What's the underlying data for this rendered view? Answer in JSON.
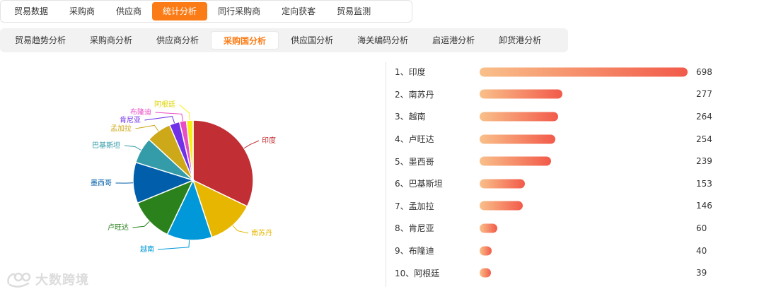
{
  "top_nav": {
    "tabs": [
      {
        "label": "贸易数据",
        "active": false
      },
      {
        "label": "采购商",
        "active": false
      },
      {
        "label": "供应商",
        "active": false
      },
      {
        "label": "统计分析",
        "active": true
      },
      {
        "label": "同行采购商",
        "active": false
      },
      {
        "label": "定向获客",
        "active": false
      },
      {
        "label": "贸易监测",
        "active": false
      }
    ]
  },
  "sub_nav": {
    "tabs": [
      {
        "label": "贸易趋势分析",
        "active": false
      },
      {
        "label": "采购商分析",
        "active": false
      },
      {
        "label": "供应商分析",
        "active": false
      },
      {
        "label": "采购国分析",
        "active": true
      },
      {
        "label": "供应国分析",
        "active": false
      },
      {
        "label": "海关编码分析",
        "active": false
      },
      {
        "label": "启运港分析",
        "active": false
      },
      {
        "label": "卸货港分析",
        "active": false
      }
    ]
  },
  "ranking": {
    "max": 698,
    "items": [
      {
        "rank_label": "1、印度",
        "value": 698
      },
      {
        "rank_label": "2、南苏丹",
        "value": 277
      },
      {
        "rank_label": "3、越南",
        "value": 264
      },
      {
        "rank_label": "4、卢旺达",
        "value": 254
      },
      {
        "rank_label": "5、墨西哥",
        "value": 239
      },
      {
        "rank_label": "6、巴基斯坦",
        "value": 153
      },
      {
        "rank_label": "7、孟加拉",
        "value": 146
      },
      {
        "rank_label": "8、肯尼亚",
        "value": 60
      },
      {
        "rank_label": "9、布隆迪",
        "value": 40
      },
      {
        "rank_label": "10、阿根廷",
        "value": 39
      }
    ]
  },
  "chart_data": {
    "type": "pie",
    "categories": [
      "印度",
      "南苏丹",
      "越南",
      "卢旺达",
      "墨西哥",
      "巴基斯坦",
      "孟加拉",
      "肯尼亚",
      "布隆迪",
      "阿根廷"
    ],
    "values": [
      698,
      277,
      264,
      254,
      239,
      153,
      146,
      60,
      40,
      39
    ],
    "colors": [
      "#c12e34",
      "#e6b600",
      "#0098d9",
      "#2b821d",
      "#005eaa",
      "#339ca8",
      "#cda819",
      "#6f30e8",
      "#e84ec5",
      "#f7f017"
    ]
  },
  "watermark": {
    "text": "大数跨境"
  }
}
